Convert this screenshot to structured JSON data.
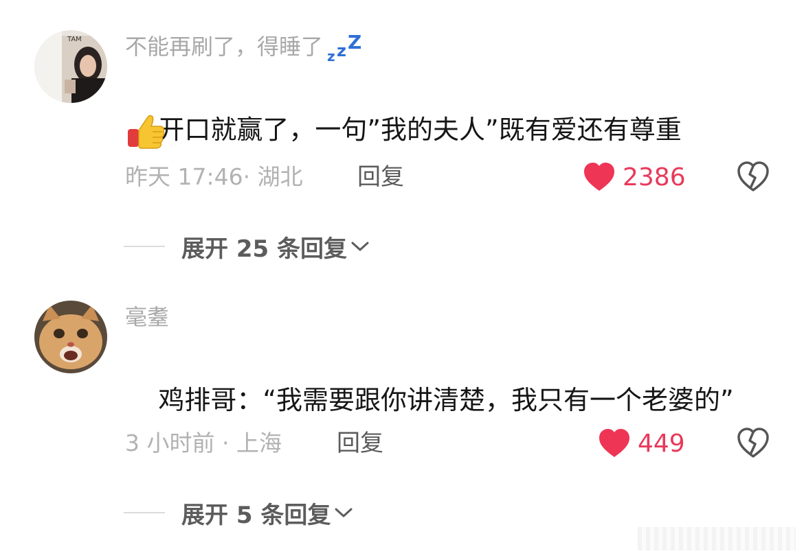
{
  "comments": [
    {
      "username": "不能再刷了，得睡了",
      "username_emoji": "zzz-icon",
      "text": "开口就赢了，一句”我的夫人”既有爱还有尊重",
      "text_emoji": "thumbs-up-icon",
      "time_location": "昨天 17:46· 湖北",
      "reply_label": "回复",
      "likes": "2386",
      "expand_label": "展开 25 条回复"
    },
    {
      "username": "毫耋",
      "text": "鸡排哥：“我需要跟你讲清楚，我只有一个老婆的”",
      "time_location": "3 小时前 · 上海",
      "reply_label": "回复",
      "likes": "449",
      "expand_label": "展开 5 条回复"
    }
  ],
  "colors": {
    "like_red": "#e8395a",
    "username_gray": "#a8a8a8",
    "text_dark": "#161616",
    "meta_gray": "#b2b2b2",
    "zzz_blue": "#2f6fd6"
  }
}
